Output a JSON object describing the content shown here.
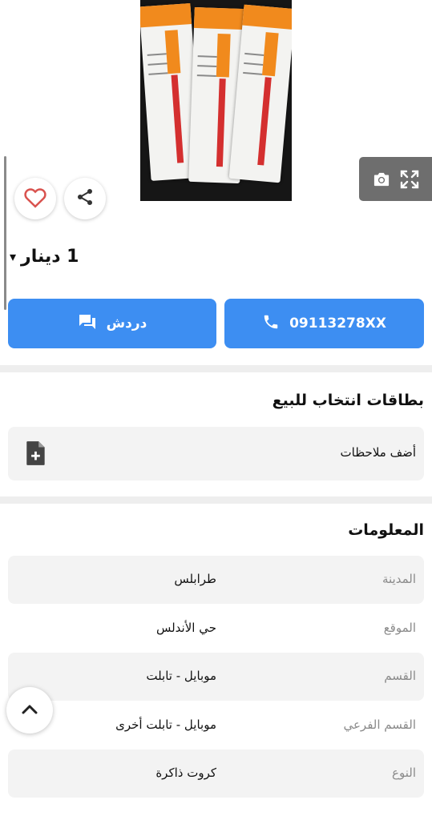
{
  "listing": {
    "price": "1 دينار",
    "price_caret": "▾",
    "title": "بطاقات انتخاب للبيع",
    "image_icon": "listing-photo"
  },
  "media_tools": {
    "camera_icon": "camera-icon",
    "fullscreen_icon": "fullscreen-icon"
  },
  "actions": {
    "chat_label": "دردش",
    "chat_icon": "chat-icon",
    "phone_label": "09113278XX",
    "phone_icon": "phone-icon",
    "favorite_icon": "heart-icon",
    "share_icon": "share-icon",
    "scroll_top_icon": "chevron-up-icon"
  },
  "notes": {
    "label": "أضف ملاحظات",
    "icon": "note-add-icon"
  },
  "info": {
    "title": "المعلومات",
    "rows": [
      {
        "label": "المدينة",
        "value": "طرابلس"
      },
      {
        "label": "الموقع",
        "value": "حي الأندلس"
      },
      {
        "label": "القسم",
        "value": "موبايل - تابلت"
      },
      {
        "label": "القسم الفرعي",
        "value": "موبايل - تابلت أخرى"
      },
      {
        "label": "النوع",
        "value": "كروت ذاكرة"
      }
    ]
  },
  "colors": {
    "accent": "#3d8ef2",
    "heart": "#d9534f",
    "row_bg": "#f3f3f3",
    "divider": "#eeeeee"
  }
}
